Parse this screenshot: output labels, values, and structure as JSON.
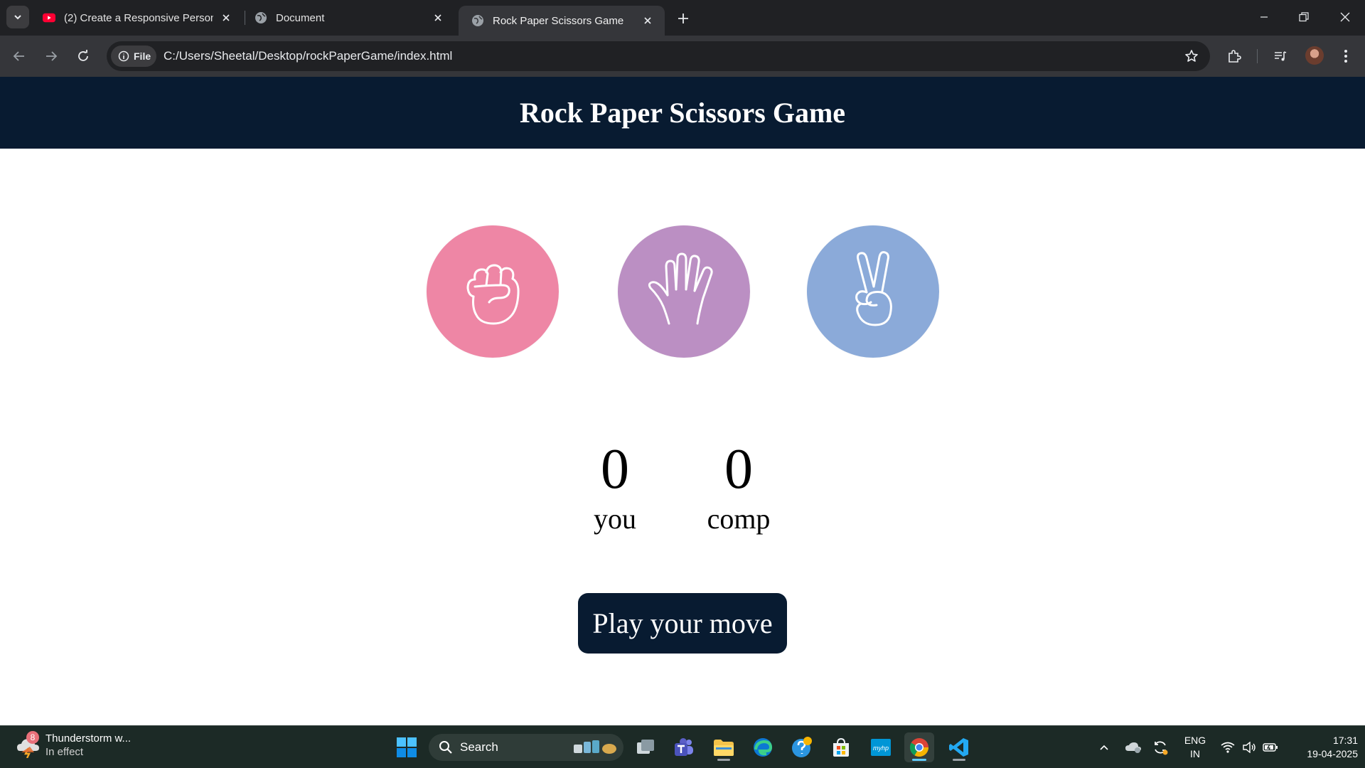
{
  "browser": {
    "tabs": [
      {
        "title": "(2) Create a Responsive Persona",
        "favicon": "youtube-icon",
        "active": false
      },
      {
        "title": "Document",
        "favicon": "globe-icon",
        "active": false
      },
      {
        "title": "Rock Paper Scissors Game",
        "favicon": "globe-icon",
        "active": true
      }
    ],
    "site_chip": "File",
    "url": "C:/Users/Sheetal/Desktop/rockPaperGame/index.html"
  },
  "page": {
    "title": "Rock Paper Scissors Game",
    "choices": [
      {
        "id": "rock",
        "icon": "fist-icon",
        "color": "#ee86a5"
      },
      {
        "id": "paper",
        "icon": "open-hand-icon",
        "color": "#bb8fc3"
      },
      {
        "id": "scissors",
        "icon": "peace-hand-icon",
        "color": "#8baad9"
      }
    ],
    "scoreboard": {
      "user_score": "0",
      "user_label": "you",
      "comp_score": "0",
      "comp_label": "comp"
    },
    "message": "Play your move",
    "header_color": "#081b31"
  },
  "taskbar": {
    "weather": {
      "badge": "8",
      "title": "Thunderstorm w...",
      "subtitle": "In effect"
    },
    "search_label": "Search",
    "lang": {
      "line1": "ENG",
      "line2": "IN"
    },
    "clock": {
      "time": "17:31",
      "date": "19-04-2025"
    }
  }
}
